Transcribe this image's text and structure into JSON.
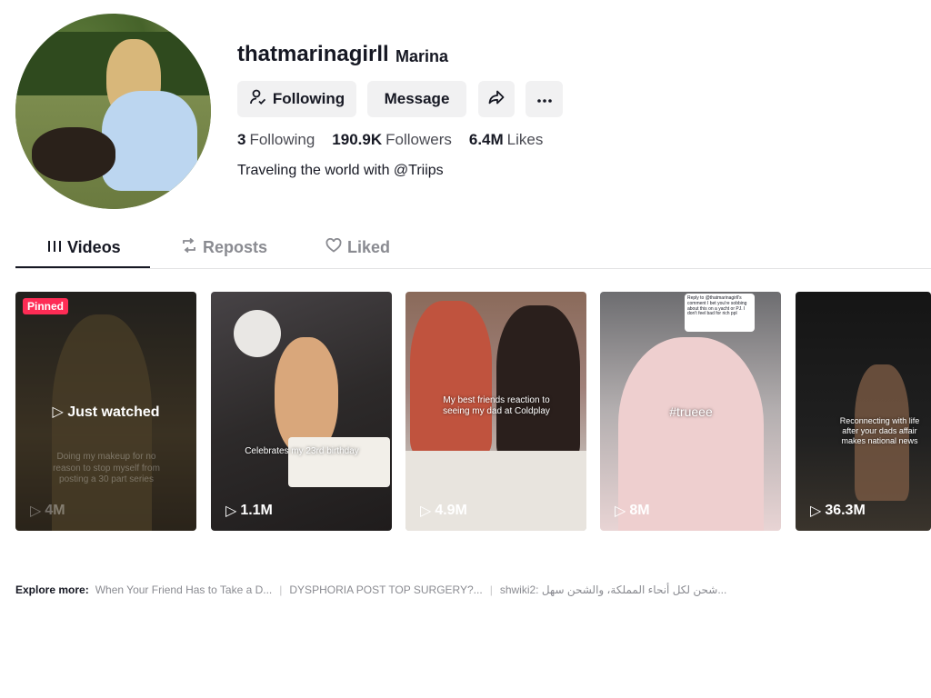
{
  "profile": {
    "username": "thatmarinagirll",
    "nickname": "Marina",
    "bio": "Traveling the world with @Triips",
    "stats": [
      {
        "value": "3",
        "label": "Following"
      },
      {
        "value": "190.9K",
        "label": "Followers"
      },
      {
        "value": "6.4M",
        "label": "Likes"
      }
    ]
  },
  "actions": {
    "following_label": "Following",
    "message_label": "Message",
    "share_icon": "share-arrow-icon",
    "more_icon": "more-dots-icon"
  },
  "tabs": [
    {
      "label": "Videos",
      "icon": "grid-icon",
      "active": true
    },
    {
      "label": "Reposts",
      "icon": "repost-icon",
      "active": false
    },
    {
      "label": "Liked",
      "icon": "heart-outline-icon",
      "active": false
    }
  ],
  "videos": [
    {
      "views": "4M",
      "badge": "Pinned",
      "overlay": "Just watched",
      "caption": "Doing my makeup for no reason to stop myself from posting a 30 part series"
    },
    {
      "views": "1.1M",
      "caption": "Celebrates my 23rd birthday"
    },
    {
      "views": "4.9M",
      "caption": "My best friends reaction to seeing my dad at Coldplay"
    },
    {
      "views": "8M",
      "caption": "#trueee",
      "reply_card": "Reply to @thatmarinagirll's comment I bet you're sobbing about this on a yacht or PJ. I don't feel bad for rich ppl"
    },
    {
      "views": "36.3M",
      "caption": "Reconnecting with life after your dads affair makes national news"
    }
  ],
  "explore": {
    "label": "Explore more:",
    "links": [
      "When Your Friend Has to Take a D...",
      "DYSPHORIA POST TOP SURGERY?...",
      "shwiki2: شحن لكل أنحاء المملكة، والشحن سهل..."
    ]
  },
  "colors": {
    "pinned_badge": "#fe2c55",
    "button_bg": "#f1f1f2",
    "text_primary": "#161823",
    "text_secondary": "#8a8b91"
  }
}
